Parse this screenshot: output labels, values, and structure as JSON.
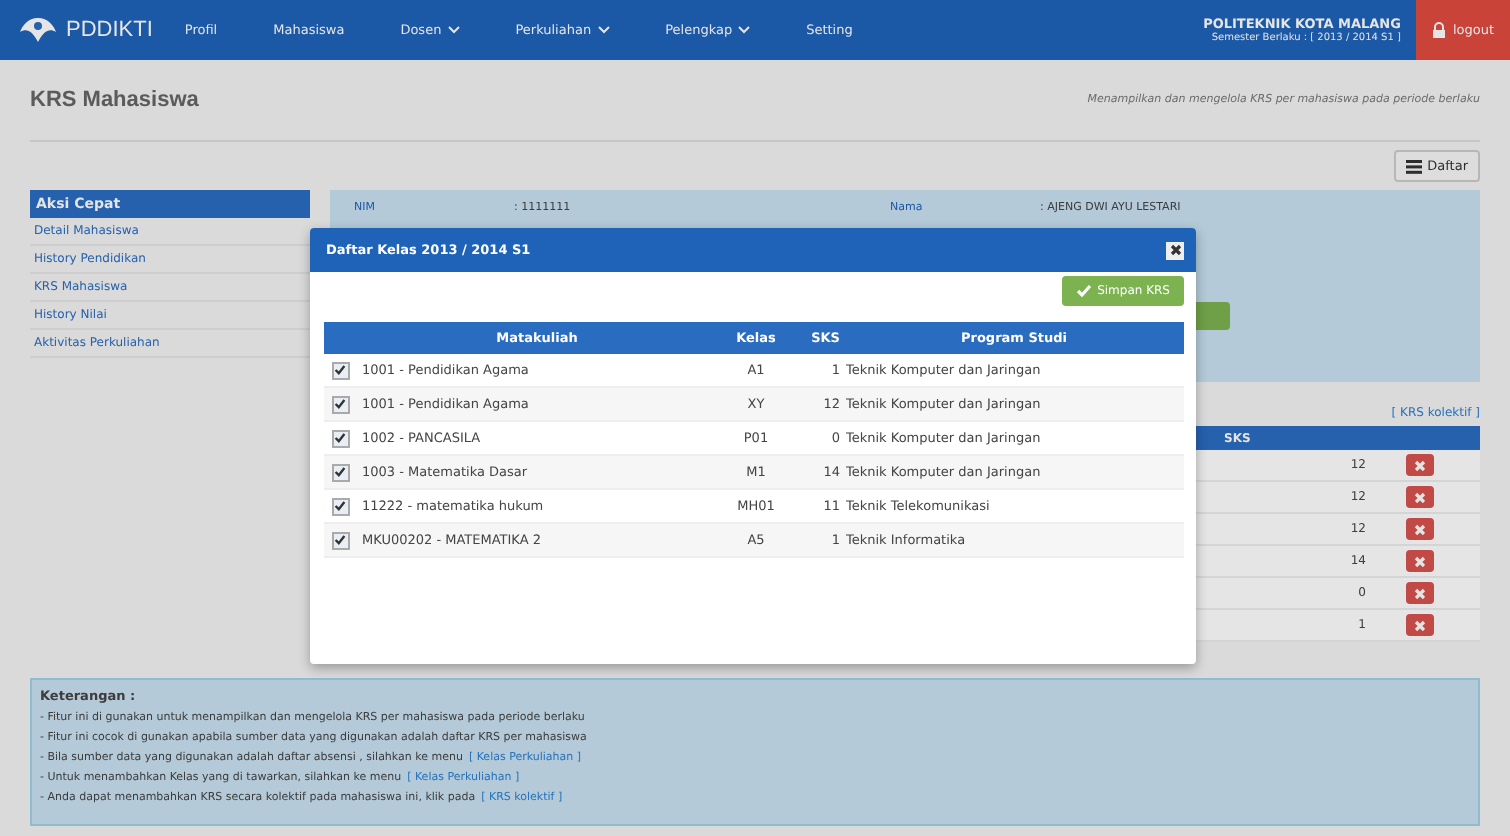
{
  "navbar": {
    "logo": "PDDIKTI",
    "items": [
      {
        "label": "Profil",
        "dropdown": false
      },
      {
        "label": "Mahasiswa",
        "dropdown": false
      },
      {
        "label": "Dosen",
        "dropdown": true
      },
      {
        "label": "Perkuliahan",
        "dropdown": true
      },
      {
        "label": "Pelengkap",
        "dropdown": true
      },
      {
        "label": "Setting",
        "dropdown": false
      }
    ],
    "institution": "POLITEKNIK KOTA MALANG",
    "semester": "Semester Berlaku : [ 2013 / 2014 S1 ]",
    "logout": "logout"
  },
  "page": {
    "title": "KRS Mahasiswa",
    "subtitle": "Menampilkan dan mengelola KRS per mahasiswa pada periode berlaku",
    "list_button": "Daftar"
  },
  "sidebar": {
    "heading": "Aksi Cepat",
    "items": [
      "Detail Mahasiswa",
      "History Pendidikan",
      "KRS Mahasiswa",
      "History Nilai",
      "Aktivitas Perkuliahan"
    ]
  },
  "student": {
    "nim_label": "NIM",
    "nim_value": ": 1111111",
    "name_label": "Nama",
    "name_value": ": AJENG DWI AYU LESTARI"
  },
  "krs_table": {
    "link": "[ KRS kolektif ]",
    "sks_header": "SKS",
    "rows": [
      "12",
      "12",
      "12",
      "14",
      "0",
      "1"
    ]
  },
  "modal": {
    "title": "Daftar Kelas 2013 / 2014 S1",
    "save_button": "Simpan KRS",
    "columns": [
      "Matakuliah",
      "Kelas",
      "SKS",
      "Program Studi"
    ],
    "rows": [
      {
        "checked": true,
        "course": "1001 - Pendidikan Agama",
        "class": "A1",
        "sks": "1",
        "program": "Teknik Komputer dan Jaringan"
      },
      {
        "checked": true,
        "course": "1001 - Pendidikan Agama",
        "class": "XY",
        "sks": "12",
        "program": "Teknik Komputer dan Jaringan"
      },
      {
        "checked": true,
        "course": "1002 - PANCASILA",
        "class": "P01",
        "sks": "0",
        "program": "Teknik Komputer dan Jaringan"
      },
      {
        "checked": true,
        "course": "1003 - Matematika Dasar",
        "class": "M1",
        "sks": "14",
        "program": "Teknik Komputer dan Jaringan"
      },
      {
        "checked": true,
        "course": "11222 - matematika hukum",
        "class": "MH01",
        "sks": "11",
        "program": "Teknik Telekomunikasi"
      },
      {
        "checked": true,
        "course": "MKU00202 - MATEMATIKA 2",
        "class": "A5",
        "sks": "1",
        "program": "Teknik Informatika"
      }
    ]
  },
  "notes": {
    "heading": "Keterangan :",
    "lines": [
      {
        "text": "- Fitur ini di gunakan untuk menampilkan dan mengelola KRS per mahasiswa pada periode berlaku"
      },
      {
        "text": "- Fitur ini cocok di gunakan apabila sumber data yang digunakan adalah daftar KRS per mahasiswa"
      },
      {
        "text": "- Bila sumber data yang digunakan adalah daftar absensi , silahkan ke menu",
        "link": "[ Kelas Perkuliahan ]"
      },
      {
        "text": "- Untuk menambahkan Kelas yang di tawarkan, silahkan ke menu",
        "link": "[ Kelas Perkuliahan ]"
      },
      {
        "text": "- Anda dapat menambahkan KRS secara kolektif pada mahasiswa ini, klik pada",
        "link": "[ KRS kolektif ]"
      }
    ]
  }
}
